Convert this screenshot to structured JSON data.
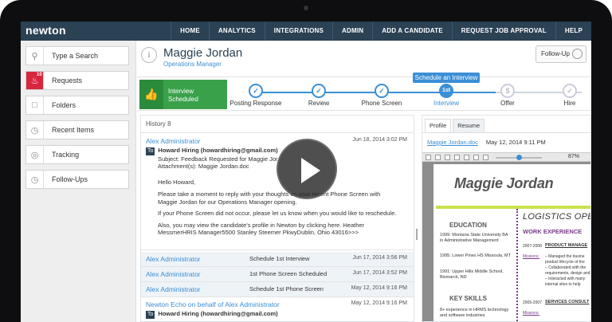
{
  "app": {
    "logo": "newton"
  },
  "nav": [
    "HOME",
    "ANALYTICS",
    "INTEGRATIONS",
    "ADMIN",
    "ADD A CANDIDATE",
    "REQUEST JOB APPROVAL",
    "HELP"
  ],
  "sidebar": {
    "items": [
      {
        "label": "Type a Search",
        "icon": "search-icon"
      },
      {
        "label": "Requests",
        "icon": "bell-icon",
        "badge": "10"
      },
      {
        "label": "Folders",
        "icon": "folder-icon"
      },
      {
        "label": "Recent Items",
        "icon": "clock-icon"
      },
      {
        "label": "Tracking",
        "icon": "target-icon"
      },
      {
        "label": "Follow-Ups",
        "icon": "clock-icon"
      }
    ]
  },
  "candidate": {
    "name": "Maggie Jordan",
    "role": "Operations Manager",
    "followup_label": "Follow-Up"
  },
  "pipeline": {
    "current_stage": "Interview Scheduled",
    "tooltip": "Schedule an Interview",
    "steps": [
      {
        "label": "Posting Response",
        "mark": "✓"
      },
      {
        "label": "Review",
        "mark": "✓"
      },
      {
        "label": "Phone Screen",
        "mark": "✓"
      },
      {
        "label": "Interview",
        "mark": "1st"
      },
      {
        "label": "Offer",
        "mark": "$"
      },
      {
        "label": "Hire",
        "mark": "✓"
      }
    ]
  },
  "history": {
    "title": "History 8",
    "first": {
      "who": "Alex Administrator",
      "when": "Jun 18, 2014 3:02 PM",
      "to_tag": "To",
      "from": "Howard Hiring (howardhiring@gmail.com)",
      "subject": "Subject: Feedback Requested for Maggie Jor",
      "attachment": "Attachment(s): Maggie Jordan.doc",
      "greeting": "Hello Howard,",
      "p1": "Please take a moment to reply with your thoughts on your recent Phone Screen with Maggie Jordan for our Operations Manager opening.",
      "p2": "If your Phone Screen did not occur, please let us know when you would like to reschedule.",
      "p3": "Also, you may view the candidate's profile in Newton by clicking here. Heather MessmerHRIS Manager5500 Stanley Steemer PkwyDublin, Ohio 43016>>>"
    },
    "rows": [
      {
        "who": "Alex Administrator",
        "what": "Schedule 1st Interview",
        "when": "Jun 17, 2014 3:56 PM"
      },
      {
        "who": "Alex Administrator",
        "what": "1st Phone Screen Scheduled",
        "when": "Jun 17, 2014 3:52 PM"
      },
      {
        "who": "Alex Administrator",
        "what": "Schedule 1st Phone Screen",
        "when": "May 12, 2014 9:16 PM"
      }
    ],
    "last": {
      "who": "Newton Echo on behalf of Alex Administrator",
      "when": "May 12, 2014 9:16 PM",
      "to_tag": "To",
      "from": "Howard Hiring (howardhiring@gmail.com)"
    }
  },
  "document": {
    "tabs": [
      "Profile",
      "Resume"
    ],
    "file": "Maggie Jordan.doc",
    "date": "May 12, 2014 9:11 PM",
    "zoom": "87%",
    "resume": {
      "name": "Maggie Jordan",
      "headline": "LOGISTICS OPERA",
      "education_title": "EDUCATION",
      "education": [
        "1999: Montana State University BA in Administrative Management",
        "1995: Lower Pines HS Missoula, MT",
        "1991: Upper Hills Middle School, Bismarck, ND"
      ],
      "skills_title": "KEY SKILLS",
      "skill": "8+ experience in HRMS technology and software industries",
      "work_title": "WORK EXPERIENCE",
      "work": [
        {
          "dates": "2007-2008",
          "title": "PRODUCT MANAGE"
        },
        {
          "dates": "2005-2007",
          "title": "SERVICES CONSULT"
        }
      ],
      "mission": "Missions:",
      "bullets": [
        "– Managed the busine",
        "product lifecycle of the",
        "– Collaborated with the",
        "requirements, design and",
        "– Interacted with many",
        "internal sites to help"
      ]
    }
  }
}
